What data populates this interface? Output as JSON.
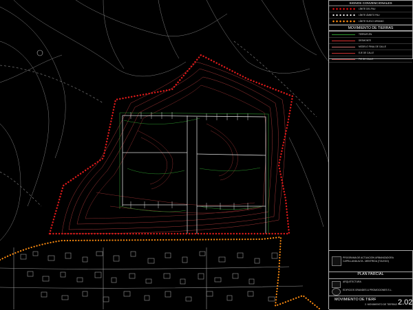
{
  "legend": {
    "title": "SIGNOS CONVENCIONALES",
    "items": [
      {
        "label": "LÍMITE DEL PAU",
        "swatch": "red-dots"
      },
      {
        "label": "LÍMITE ÁMBITO PAU",
        "swatch": "white-dots"
      },
      {
        "label": "LÍMITE SUELO URBANO",
        "swatch": "orange-dots"
      }
    ]
  },
  "earthworks": {
    "title": "MOVIMIENTO DE TIERRAS",
    "items": [
      {
        "label": "TERRAPLÉN",
        "color": "#2f9b2f"
      },
      {
        "label": "DESMONTE",
        "color": "#e03030"
      },
      {
        "label": "MODELO FINAL DE CALLE",
        "color": "#d07070"
      },
      {
        "label": "EJE DE CALLE",
        "color": "#cc3333"
      },
      {
        "label": "PIE DE CALLE",
        "color": "#bb4444"
      }
    ]
  },
  "title_block": {
    "program_line1": "PROGRAMA DE ACTUACIÓN URBANIZADORA",
    "program_line2": "CAPELLANÍA ALTA - MENTRIDA (TOLEDO)",
    "plan_title": "PLAN PARCIAL",
    "architect_role": "ARQUITECTURA",
    "developer_line1": "EDIFICIOS GRANDES & PROMOCIONES S.L.",
    "drawing_title": "MOVIMIENTO DE TIERRAS",
    "drawing_subtitle": "2. MOVIMIENTO DE TIERRAS",
    "sheet_number": "2.02"
  },
  "colors": {
    "boundary_red": "#e01a1a",
    "boundary_orange": "#ff8c10",
    "contour_red": "#a83838",
    "contour_green": "#2e9a2e",
    "lines_white": "#d8d8d8"
  }
}
